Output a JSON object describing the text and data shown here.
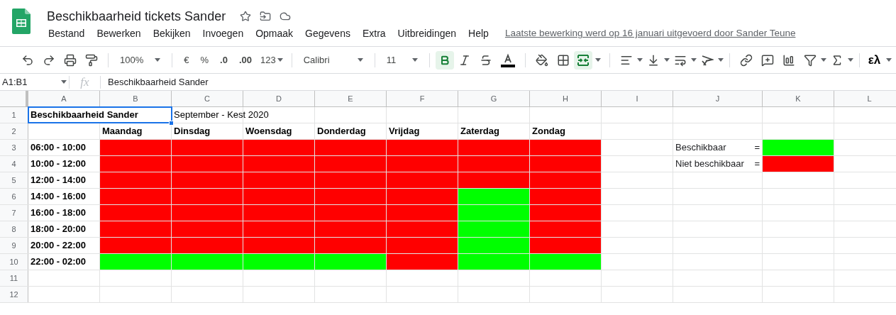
{
  "document": {
    "title": "Beschikbaarheid tickets Sander",
    "last_edit": "Laatste bewerking werd op 16 januari uitgevoerd door Sander Teune"
  },
  "menu": [
    "Bestand",
    "Bewerken",
    "Bekijken",
    "Invoegen",
    "Opmaak",
    "Gegevens",
    "Extra",
    "Uitbreidingen",
    "Help"
  ],
  "toolbar": {
    "zoom": "100%",
    "currency": "€",
    "percent": "%",
    "decrease_decimals": ".0",
    "increase_decimals": ".00",
    "number_format": "123",
    "font": "Calibri",
    "font_size": "11",
    "bold_active": true,
    "merge_active": true,
    "input_tools": "ελ"
  },
  "formula_bar": {
    "name_box": "A1:B1",
    "fx": "fx",
    "content": "Beschikbaarheid Sander"
  },
  "columns": [
    "A",
    "B",
    "C",
    "D",
    "E",
    "F",
    "G",
    "H",
    "I",
    "J",
    "K",
    "L"
  ],
  "rows": [
    {
      "number": "1",
      "cells": [
        {
          "kind": "merged",
          "text": "Beschikbaarheid Sander",
          "bold": true,
          "selected": true
        },
        {
          "kind": "text",
          "text": "September - Kest 2020",
          "bold": false
        },
        {
          "kind": "empty"
        },
        {
          "kind": "empty"
        },
        {
          "kind": "empty"
        },
        {
          "kind": "empty"
        },
        {
          "kind": "empty"
        },
        {
          "kind": "empty"
        },
        {
          "kind": "empty"
        },
        {
          "kind": "empty"
        }
      ]
    },
    {
      "number": "2",
      "cells": [
        {
          "kind": "empty"
        },
        {
          "kind": "text",
          "text": "Maandag",
          "bold": true
        },
        {
          "kind": "text",
          "text": "Dinsdag",
          "bold": true
        },
        {
          "kind": "text",
          "text": "Woensdag",
          "bold": true
        },
        {
          "kind": "text",
          "text": "Donderdag",
          "bold": true
        },
        {
          "kind": "text",
          "text": "Vrijdag",
          "bold": true
        },
        {
          "kind": "text",
          "text": "Zaterdag",
          "bold": true
        },
        {
          "kind": "text",
          "text": "Zondag",
          "bold": true
        },
        {
          "kind": "empty"
        },
        {
          "kind": "empty"
        },
        {
          "kind": "empty"
        },
        {
          "kind": "empty"
        }
      ]
    },
    {
      "number": "3",
      "cells": [
        {
          "kind": "text",
          "text": "06:00 - 10:00",
          "bold": true
        },
        {
          "kind": "slot",
          "available": false
        },
        {
          "kind": "slot",
          "available": false
        },
        {
          "kind": "slot",
          "available": false
        },
        {
          "kind": "slot",
          "available": false
        },
        {
          "kind": "slot",
          "available": false
        },
        {
          "kind": "slot",
          "available": false
        },
        {
          "kind": "slot",
          "available": false
        },
        {
          "kind": "empty"
        },
        {
          "kind": "legend",
          "label": "Beschikbaar",
          "sign": "="
        },
        {
          "kind": "slot",
          "available": true
        },
        {
          "kind": "empty"
        }
      ]
    },
    {
      "number": "4",
      "cells": [
        {
          "kind": "text",
          "text": "10:00 - 12:00",
          "bold": true
        },
        {
          "kind": "slot",
          "available": false
        },
        {
          "kind": "slot",
          "available": false
        },
        {
          "kind": "slot",
          "available": false
        },
        {
          "kind": "slot",
          "available": false
        },
        {
          "kind": "slot",
          "available": false
        },
        {
          "kind": "slot",
          "available": false
        },
        {
          "kind": "slot",
          "available": false
        },
        {
          "kind": "empty"
        },
        {
          "kind": "legend",
          "label": "Niet beschikbaar",
          "sign": "="
        },
        {
          "kind": "slot",
          "available": false
        },
        {
          "kind": "empty"
        }
      ]
    },
    {
      "number": "5",
      "cells": [
        {
          "kind": "text",
          "text": "12:00 - 14:00",
          "bold": true
        },
        {
          "kind": "slot",
          "available": false
        },
        {
          "kind": "slot",
          "available": false
        },
        {
          "kind": "slot",
          "available": false
        },
        {
          "kind": "slot",
          "available": false
        },
        {
          "kind": "slot",
          "available": false
        },
        {
          "kind": "slot",
          "available": false
        },
        {
          "kind": "slot",
          "available": false
        },
        {
          "kind": "empty"
        },
        {
          "kind": "empty"
        },
        {
          "kind": "empty"
        },
        {
          "kind": "empty"
        }
      ]
    },
    {
      "number": "6",
      "cells": [
        {
          "kind": "text",
          "text": "14:00 - 16:00",
          "bold": true
        },
        {
          "kind": "slot",
          "available": false
        },
        {
          "kind": "slot",
          "available": false
        },
        {
          "kind": "slot",
          "available": false
        },
        {
          "kind": "slot",
          "available": false
        },
        {
          "kind": "slot",
          "available": false
        },
        {
          "kind": "slot",
          "available": true
        },
        {
          "kind": "slot",
          "available": false
        },
        {
          "kind": "empty"
        },
        {
          "kind": "empty"
        },
        {
          "kind": "empty"
        },
        {
          "kind": "empty"
        }
      ]
    },
    {
      "number": "7",
      "cells": [
        {
          "kind": "text",
          "text": "16:00 - 18:00",
          "bold": true
        },
        {
          "kind": "slot",
          "available": false
        },
        {
          "kind": "slot",
          "available": false
        },
        {
          "kind": "slot",
          "available": false
        },
        {
          "kind": "slot",
          "available": false
        },
        {
          "kind": "slot",
          "available": false
        },
        {
          "kind": "slot",
          "available": true
        },
        {
          "kind": "slot",
          "available": false
        },
        {
          "kind": "empty"
        },
        {
          "kind": "empty"
        },
        {
          "kind": "empty"
        },
        {
          "kind": "empty"
        }
      ]
    },
    {
      "number": "8",
      "cells": [
        {
          "kind": "text",
          "text": "18:00 - 20:00",
          "bold": true
        },
        {
          "kind": "slot",
          "available": false
        },
        {
          "kind": "slot",
          "available": false
        },
        {
          "kind": "slot",
          "available": false
        },
        {
          "kind": "slot",
          "available": false
        },
        {
          "kind": "slot",
          "available": false
        },
        {
          "kind": "slot",
          "available": true
        },
        {
          "kind": "slot",
          "available": false
        },
        {
          "kind": "empty"
        },
        {
          "kind": "empty"
        },
        {
          "kind": "empty"
        },
        {
          "kind": "empty"
        }
      ]
    },
    {
      "number": "9",
      "cells": [
        {
          "kind": "text",
          "text": "20:00 - 22:00",
          "bold": true
        },
        {
          "kind": "slot",
          "available": false
        },
        {
          "kind": "slot",
          "available": false
        },
        {
          "kind": "slot",
          "available": false
        },
        {
          "kind": "slot",
          "available": false
        },
        {
          "kind": "slot",
          "available": false
        },
        {
          "kind": "slot",
          "available": true
        },
        {
          "kind": "slot",
          "available": false
        },
        {
          "kind": "empty"
        },
        {
          "kind": "empty"
        },
        {
          "kind": "empty"
        },
        {
          "kind": "empty"
        }
      ]
    },
    {
      "number": "10",
      "cells": [
        {
          "kind": "text",
          "text": "22:00 - 02:00",
          "bold": true
        },
        {
          "kind": "slot",
          "available": true
        },
        {
          "kind": "slot",
          "available": true
        },
        {
          "kind": "slot",
          "available": true
        },
        {
          "kind": "slot",
          "available": true
        },
        {
          "kind": "slot",
          "available": false
        },
        {
          "kind": "slot",
          "available": true
        },
        {
          "kind": "slot",
          "available": true
        },
        {
          "kind": "empty"
        },
        {
          "kind": "empty"
        },
        {
          "kind": "empty"
        },
        {
          "kind": "empty"
        }
      ]
    },
    {
      "number": "11",
      "cells": []
    },
    {
      "number": "12",
      "cells": []
    }
  ]
}
